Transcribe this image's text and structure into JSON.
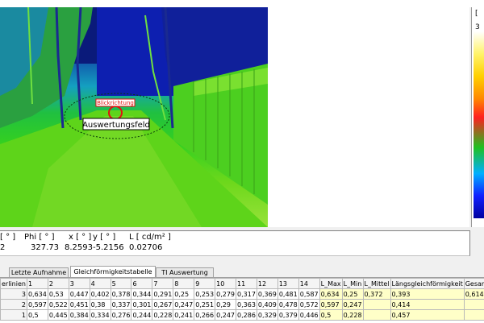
{
  "scene": {
    "view_direction_label": "Blickrichtung",
    "evaluation_field_label": "Auswertungsfeld"
  },
  "scale": {
    "top_label_partial": "[",
    "value_label_partial": "3"
  },
  "readout": {
    "labels": [
      "[ ° ]",
      "Phi [ ° ]",
      "x [ ° ]",
      "y [ ° ]",
      "L [ cd/m² ]"
    ],
    "values": [
      "2",
      "327.73",
      "8.2593",
      "-5.2156",
      "0.02706"
    ]
  },
  "tabs": [
    {
      "label": "Letzte Aufnahme",
      "active": false
    },
    {
      "label": "Gleichförmigkeitstabelle",
      "active": true
    },
    {
      "label": "TI Auswertung",
      "active": false
    }
  ],
  "table": {
    "headers": [
      "erlinien",
      "1",
      "2",
      "3",
      "4",
      "5",
      "6",
      "7",
      "8",
      "9",
      "10",
      "11",
      "12",
      "13",
      "14",
      "L_Max",
      "L_Min",
      "L_Mittel",
      "Längsgleichförmigkeit",
      "Gesamtgleich"
    ],
    "rows": [
      [
        "3",
        "0,634",
        "0,53",
        "0,447",
        "0,402",
        "0,378",
        "0,344",
        "0,291",
        "0,25",
        "0,253",
        "0,279",
        "0,317",
        "0,369",
        "0,481",
        "0,587",
        "0,634",
        "0,25",
        "0,372",
        "0,393",
        "0,614"
      ],
      [
        "2",
        "0,597",
        "0,522",
        "0,451",
        "0,38",
        "0,337",
        "0,301",
        "0,267",
        "0,247",
        "0,251",
        "0,29",
        "0,363",
        "0,409",
        "0,478",
        "0,572",
        "0,597",
        "0,247",
        "",
        "0,414",
        ""
      ],
      [
        "1",
        "0,5",
        "0,445",
        "0,384",
        "0,334",
        "0,276",
        "0,244",
        "0,228",
        "0,241",
        "0,266",
        "0,247",
        "0,286",
        "0,329",
        "0,379",
        "0,446",
        "0,5",
        "0,228",
        "",
        "0,457",
        ""
      ]
    ]
  }
}
